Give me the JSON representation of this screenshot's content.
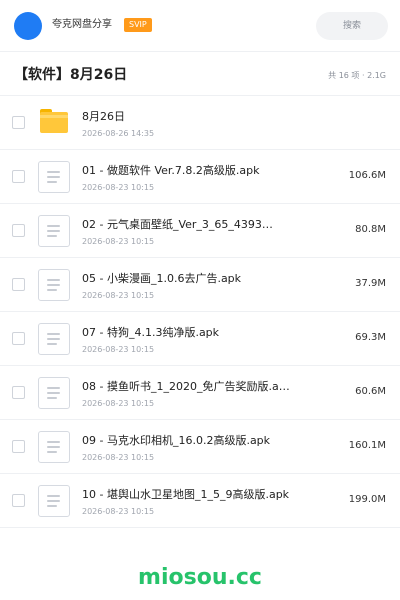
{
  "header": {
    "username": "夸克网盘分享",
    "badge": "SVIP",
    "search_placeholder": "搜索",
    "accent": "#1f7cf4"
  },
  "folder": {
    "title": "【软件】8月26日",
    "meta": "共 16 项 · 2.1G"
  },
  "files": [
    {
      "icon": "folder-icon",
      "name": "8月26日",
      "date": "2026-08-26 14:35",
      "size": ""
    },
    {
      "icon": "file-icon",
      "name": "01 - 做题软件 Ver.7.8.2高级版.apk",
      "date": "2026-08-23 10:15",
      "size": "106.6M"
    },
    {
      "icon": "file-icon",
      "name": "02 - 元气桌面壁纸_Ver_3_65_4393…",
      "date": "2026-08-23 10:15",
      "size": "80.8M"
    },
    {
      "icon": "file-icon",
      "name": "05 - 小柴漫画_1.0.6去广告.apk",
      "date": "2026-08-23 10:15",
      "size": "37.9M"
    },
    {
      "icon": "file-icon",
      "name": "07 - 特狗_4.1.3纯净版.apk",
      "date": "2026-08-23 10:15",
      "size": "69.3M"
    },
    {
      "icon": "file-icon",
      "name": "08 - 摸鱼听书_1_2020_免广告奖励版.a…",
      "date": "2026-08-23 10:15",
      "size": "60.6M"
    },
    {
      "icon": "file-icon",
      "name": "09 - 马克水印相机_16.0.2高级版.apk",
      "date": "2026-08-23 10:15",
      "size": "160.1M"
    },
    {
      "icon": "file-icon",
      "name": "10 - 堪舆山水卫星地图_1_5_9高级版.apk",
      "date": "2026-08-23 10:15",
      "size": "199.0M"
    }
  ],
  "footer": {
    "watermark": "miosou.cc",
    "watermark_color": "#27c36b"
  }
}
